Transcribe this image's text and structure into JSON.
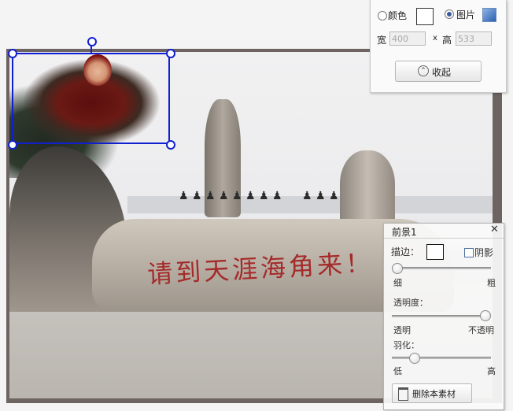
{
  "photo": {
    "engraving_text": "请到天涯海角来！"
  },
  "top_panel": {
    "color_label": "颜色",
    "color_selected": false,
    "image_label": "图片",
    "image_selected": true,
    "width_label": "宽",
    "width_value": "400",
    "separator": "x",
    "height_label": "高",
    "height_value": "533",
    "collapse_label": "收起",
    "collapse_icon": "chevron-up-icon"
  },
  "foreground_panel": {
    "title": "前景1",
    "close_glyph": "✕",
    "stroke_label": "描边：",
    "shadow_label": "阴影",
    "shadow_checked": false,
    "thin_label": "细",
    "thick_label": "粗",
    "stroke_level": 0.0,
    "opacity_label": "透明度：",
    "transparent_label": "透明",
    "opaque_label": "不透明",
    "opacity_level": 1.0,
    "feather_label": "羽化：",
    "low_label": "低",
    "high_label": "高",
    "feather_level": 0.2,
    "delete_label": "删除本素材",
    "delete_icon": "trash-icon"
  },
  "colors": {
    "selection": "#1020d0",
    "engraving": "#a52a2a"
  }
}
